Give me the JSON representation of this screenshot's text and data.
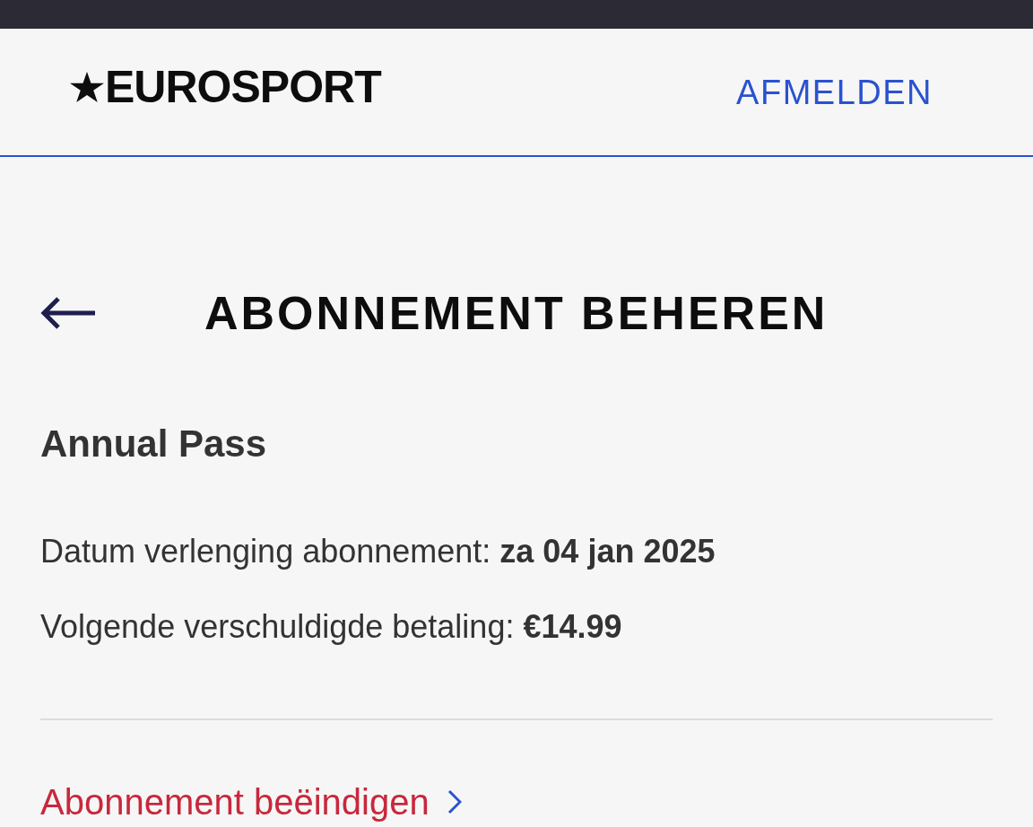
{
  "header": {
    "logo": "EUROSPORT",
    "logout_link": "AFMELDEN"
  },
  "page": {
    "title": "ABONNEMENT BEHEREN"
  },
  "subscription": {
    "plan": "Annual Pass",
    "details": [
      "Datum verlenging abonnement: **za 04 jan 2025**",
      "Volgende verschuldigde betaling: **€14.99**"
    ]
  },
  "cancel_link": "Abonnement beëindigen"
}
